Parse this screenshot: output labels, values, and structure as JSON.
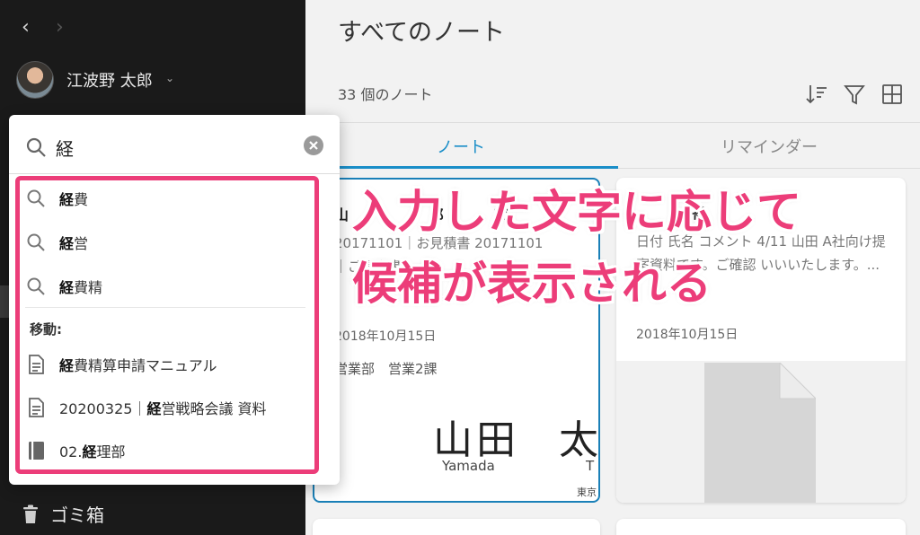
{
  "sidebar": {
    "back_glyph": "‹",
    "forward_glyph": "›",
    "user_name": "江波野 太郎",
    "user_caret": "⌄",
    "trash_label": "ゴミ箱"
  },
  "main": {
    "title": "すべてのノート",
    "note_count": "33 個のノート",
    "tabs": [
      {
        "label": "ノート",
        "active": true
      },
      {
        "label": "リマインダー",
        "active": false
      }
    ]
  },
  "cards": [
    {
      "title_left": "山",
      "title_mid": "郎",
      "title_right": "東",
      "snippet_lines": [
        "20171101｜お見積書 20171101",
        "｜ご提案書"
      ],
      "date": "2018年10月15日",
      "dept": "営業部　営業2課",
      "surname": "山田",
      "given": "太",
      "roman1": "Yamada",
      "roman2": "T",
      "foot": "東京"
    },
    {
      "title_right": "書",
      "snippet": "日付 氏名 コメント 4/11 山田 A社向け提案資料です。ご確認 いいいたします。...",
      "date": "2018年10月15日"
    }
  ],
  "search": {
    "query": "経",
    "suggestions": [
      {
        "match": "経",
        "rest": "費"
      },
      {
        "match": "経",
        "rest": "営"
      },
      {
        "match": "経",
        "rest": "費精"
      }
    ],
    "jump_heading": "移動:",
    "jump_items": [
      {
        "icon": "note-icon",
        "match": "経",
        "rest": "費精算申請マニュアル",
        "prefix": ""
      },
      {
        "icon": "note-icon",
        "match": "経",
        "rest": "営戦略会議 資料",
        "prefix": "20200325｜"
      },
      {
        "icon": "notebook-icon",
        "match": "経",
        "rest": "理部",
        "prefix": "02."
      }
    ]
  },
  "annotation": {
    "line1": "入力した文字に応じて",
    "line2": "候補が表示される"
  },
  "colors": {
    "accent": "#1a8ec8",
    "highlight": "#ec3d79",
    "sidebar_bg": "#1a1a1a"
  }
}
